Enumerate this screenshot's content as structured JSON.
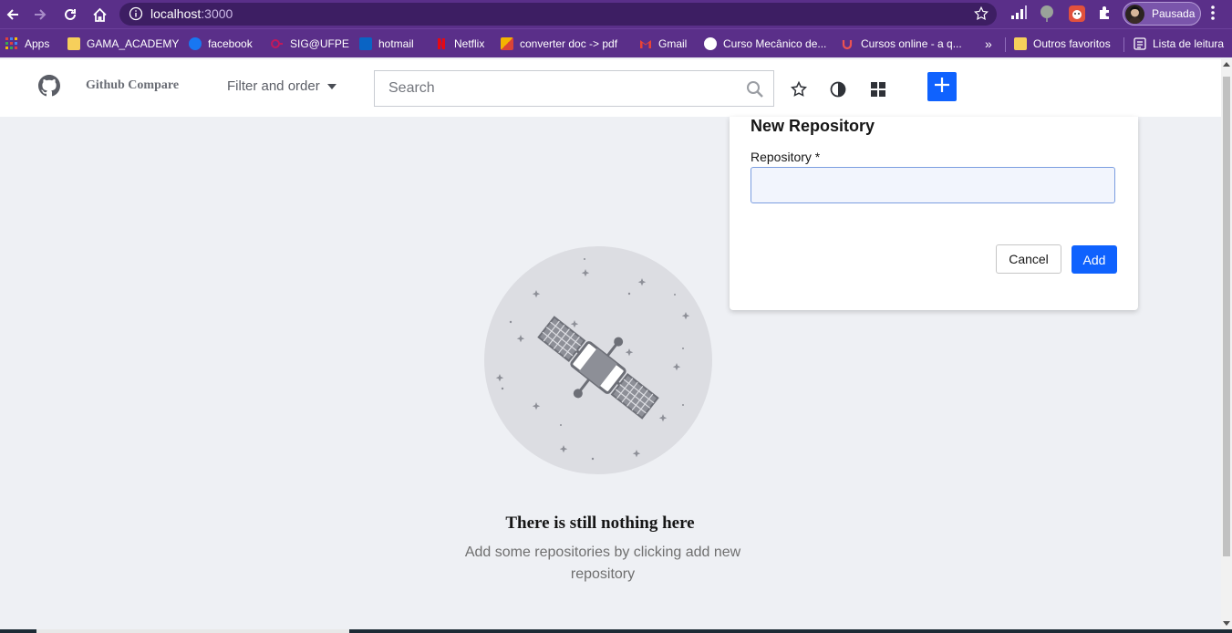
{
  "browser": {
    "url_host": "localhost",
    "url_port": ":3000",
    "profile_label": "Pausada",
    "bookmarks": [
      {
        "label": "Apps",
        "icon": "apps-grid-icon",
        "color": "#e0413c"
      },
      {
        "label": "GAMA_ACADEMY",
        "icon": "folder-icon",
        "color": "#f6cf5b"
      },
      {
        "label": "facebook",
        "icon": "facebook-icon",
        "color": "#1877f2"
      },
      {
        "label": "SIG@UFPE",
        "icon": "sig-icon",
        "color": "#c2185b"
      },
      {
        "label": "hotmail",
        "icon": "outlook-icon",
        "color": "#0a64c4"
      },
      {
        "label": "Netflix",
        "icon": "netflix-icon",
        "color": "#e50914"
      },
      {
        "label": "converter doc -> pdf",
        "icon": "converter-icon",
        "color": "#f4b400"
      },
      {
        "label": "Gmail",
        "icon": "gmail-icon",
        "color": "#ea4335"
      },
      {
        "label": "Curso Mecânico de...",
        "icon": "course-icon",
        "color": "#ffffff"
      },
      {
        "label": "Cursos online - a q...",
        "icon": "udemy-icon",
        "color": "#ec5252"
      }
    ],
    "overflow_label": "»",
    "other_bookmarks": "Outros favoritos",
    "reading_list": "Lista de leitura"
  },
  "header": {
    "app_title": "Github Compare",
    "filter_label": "Filter and order",
    "search_placeholder": "Search"
  },
  "empty_state": {
    "title": "There is still nothing here",
    "description": "Add some repositories by clicking add new repository"
  },
  "modal": {
    "title": "New Repository",
    "field_label": "Repository *",
    "field_value": "",
    "cancel_label": "Cancel",
    "add_label": "Add"
  },
  "colors": {
    "accent": "#0f62fe",
    "chrome": "#5a2f89",
    "page_bg": "#eef0f4"
  }
}
